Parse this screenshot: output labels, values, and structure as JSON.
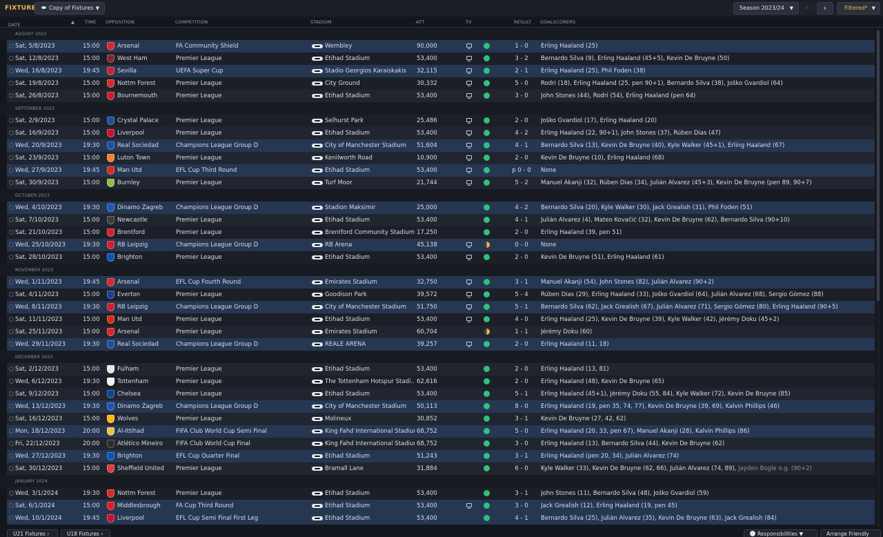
{
  "header": {
    "title": "FIXTURES",
    "view_select": "Copy of Fixtures",
    "season_select": "Season 2023/24",
    "filter_label": "Filtered*",
    "prev_icon": "chevron-left-icon",
    "next_icon": "chevron-right-icon"
  },
  "columns": {
    "date": "DATE",
    "time": "TIME",
    "opposition": "OPPOSITION",
    "competition": "COMPETITION",
    "stadium": "STADIUM",
    "att": "ATT",
    "tv": "TV",
    "result": "RESULT",
    "goalscorers": "GOALSCORERS"
  },
  "colors": {
    "accent": "#e9b94a",
    "win_dot": "#2fc27a",
    "draw_dot": "#f2b33a",
    "highlight_row": "#263752"
  },
  "groups": [
    {
      "month": "AUGUST 2023",
      "fixtures": [
        {
          "date": "Sat, 5/8/2023",
          "time": "15:00",
          "opp": "Arsenal",
          "crest": "#d8262b",
          "comp": "FA Community Shield",
          "stadium": "Wembley",
          "att": "90,000",
          "tv": true,
          "result": "1 - 0",
          "outcome": "win",
          "scorers": "Erling Haaland (25)",
          "scorers_extra": "",
          "hl": true
        },
        {
          "date": "Sat, 12/8/2023",
          "time": "15:00",
          "opp": "West Ham",
          "crest": "#7a2636",
          "comp": "Premier League",
          "stadium": "Etihad Stadium",
          "att": "53,400",
          "tv": true,
          "result": "3 - 2",
          "outcome": "win",
          "scorers": "Bernardo Silva (9), Erling Haaland (45+5), Kevin De Bruyne (50)",
          "scorers_extra": "",
          "hl": false
        },
        {
          "date": "Wed, 16/8/2023",
          "time": "19:45",
          "opp": "Sevilla",
          "crest": "#c7202c",
          "comp": "UEFA Super Cup",
          "stadium": "Stadio Georgios Karaiskakis",
          "att": "32,115",
          "tv": true,
          "result": "2 - 1",
          "outcome": "win",
          "scorers": "Erling Haaland (25), Phil Foden (38)",
          "scorers_extra": "",
          "hl": true
        },
        {
          "date": "Sat, 19/8/2023",
          "time": "15:00",
          "opp": "Nottm Forest",
          "crest": "#d12b2b",
          "comp": "Premier League",
          "stadium": "City Ground",
          "att": "30,332",
          "tv": true,
          "result": "5 - 0",
          "outcome": "win",
          "scorers": "Rodri (18), Erling Haaland (25, pen 90+1), Bernardo Silva (38), Joško Gvardiol (64)",
          "scorers_extra": "",
          "hl": false
        },
        {
          "date": "Sat, 26/8/2023",
          "time": "15:00",
          "opp": "Bournemouth",
          "crest": "#c61f2b",
          "comp": "Premier League",
          "stadium": "Etihad Stadium",
          "att": "53,400",
          "tv": true,
          "result": "3 - 0",
          "outcome": "win",
          "scorers": "John Stones (44), Rodri (54), Erling Haaland (pen 64)",
          "scorers_extra": "",
          "hl": false
        }
      ]
    },
    {
      "month": "SEPTEMBER 2023",
      "fixtures": [
        {
          "date": "Sat, 2/9/2023",
          "time": "15:00",
          "opp": "Crystal Palace",
          "crest": "#1b4e9b",
          "comp": "Premier League",
          "stadium": "Selhurst Park",
          "att": "25,486",
          "tv": true,
          "result": "2 - 0",
          "outcome": "win",
          "scorers": "Joško Gvardiol (17), Erling Haaland (20)",
          "scorers_extra": "",
          "hl": false
        },
        {
          "date": "Sat, 16/9/2023",
          "time": "15:00",
          "opp": "Liverpool",
          "crest": "#c8102e",
          "comp": "Premier League",
          "stadium": "Etihad Stadium",
          "att": "53,400",
          "tv": true,
          "result": "4 - 2",
          "outcome": "win",
          "scorers": "Erling Haaland (22, 90+1), John Stones (37), Rúben Dias (47)",
          "scorers_extra": "",
          "hl": false
        },
        {
          "date": "Wed, 20/9/2023",
          "time": "19:30",
          "opp": "Real Sociedad",
          "crest": "#1c4ea0",
          "comp": "Champions League Group D",
          "stadium": "City of Manchester Stadium",
          "att": "51,604",
          "tv": true,
          "result": "4 - 1",
          "outcome": "win",
          "scorers": "Bernardo Silva (13), Kevin De Bruyne (40), Kyle Walker (45+1), Erling Haaland (67)",
          "scorers_extra": "",
          "hl": true
        },
        {
          "date": "Sat, 23/9/2023",
          "time": "15:00",
          "opp": "Luton Town",
          "crest": "#f0822a",
          "comp": "Premier League",
          "stadium": "Kenilworth Road",
          "att": "10,900",
          "tv": true,
          "result": "2 - 0",
          "outcome": "win",
          "scorers": "Kevin De Bruyne (10), Erling Haaland (68)",
          "scorers_extra": "",
          "hl": false
        },
        {
          "date": "Wed, 27/9/2023",
          "time": "19:45",
          "opp": "Man Utd",
          "crest": "#da291c",
          "comp": "EFL Cup Third Round",
          "stadium": "Etihad Stadium",
          "att": "53,400",
          "tv": true,
          "result": "p 0 - 0",
          "outcome": "win",
          "scorers": "None",
          "scorers_extra": "",
          "hl": true
        },
        {
          "date": "Sat, 30/9/2023",
          "time": "15:00",
          "opp": "Burnley",
          "crest": "#8cbf3f",
          "comp": "Premier League",
          "stadium": "Turf Moor",
          "att": "21,744",
          "tv": true,
          "result": "5 - 2",
          "outcome": "win",
          "scorers": "Manuel Akanji (32), Rúben Dias (34), Julián Álvarez (45+3), Kevin De Bruyne (pen 89, 90+7)",
          "scorers_extra": "",
          "hl": false
        }
      ]
    },
    {
      "month": "OCTOBER 2023",
      "fixtures": [
        {
          "date": "Wed, 4/10/2023",
          "time": "19:30",
          "opp": "Dinamo Zagreb",
          "crest": "#1c55b8",
          "comp": "Champions League Group D",
          "stadium": "Stadion Maksimir",
          "att": "25,000",
          "tv": false,
          "result": "4 - 2",
          "outcome": "win",
          "scorers": "Bernardo Silva (20), Kyle Walker (30), Jack Grealish (31), Phil Foden (51)",
          "scorers_extra": "",
          "hl": true
        },
        {
          "date": "Sat, 7/10/2023",
          "time": "15:00",
          "opp": "Newcastle",
          "crest": "#3b3b3b",
          "comp": "Premier League",
          "stadium": "Etihad Stadium",
          "att": "53,400",
          "tv": false,
          "result": "4 - 1",
          "outcome": "win",
          "scorers": "Julián Álvarez (4), Mateo Kovačić (32), Kevin De Bruyne (62), Bernardo Silva (90+10)",
          "scorers_extra": "",
          "hl": false
        },
        {
          "date": "Sat, 21/10/2023",
          "time": "15:00",
          "opp": "Brentford",
          "crest": "#d81f26",
          "comp": "Premier League",
          "stadium": "Brentford Community Stadium",
          "att": "17,250",
          "tv": false,
          "result": "2 - 0",
          "outcome": "win",
          "scorers": "Erling Haaland (39, pen 51)",
          "scorers_extra": "",
          "hl": false
        },
        {
          "date": "Wed, 25/10/2023",
          "time": "19:30",
          "opp": "RB Leipzig",
          "crest": "#d01d2f",
          "comp": "Champions League Group D",
          "stadium": "RB Arena",
          "att": "45,138",
          "tv": true,
          "result": "0 - 0",
          "outcome": "draw",
          "scorers": "None",
          "scorers_extra": "",
          "hl": true
        },
        {
          "date": "Sat, 28/10/2023",
          "time": "15:00",
          "opp": "Brighton",
          "crest": "#0057b8",
          "comp": "Premier League",
          "stadium": "Etihad Stadium",
          "att": "53,400",
          "tv": true,
          "result": "2 - 0",
          "outcome": "win",
          "scorers": "Kevin De Bruyne (51), Erling Haaland (61)",
          "scorers_extra": "",
          "hl": false
        }
      ]
    },
    {
      "month": "NOVEMBER 2023",
      "fixtures": [
        {
          "date": "Wed, 1/11/2023",
          "time": "19:45",
          "opp": "Arsenal",
          "crest": "#d8262b",
          "comp": "EFL Cup Fourth Round",
          "stadium": "Emirates Stadium",
          "att": "32,750",
          "tv": true,
          "result": "3 - 1",
          "outcome": "win",
          "scorers": "Manuel Akanji (54), John Stones (82), Julián Álvarez (90+2)",
          "scorers_extra": "",
          "hl": true
        },
        {
          "date": "Sat, 4/11/2023",
          "time": "15:00",
          "opp": "Everton",
          "crest": "#1b3f94",
          "comp": "Premier League",
          "stadium": "Goodison Park",
          "att": "39,572",
          "tv": true,
          "result": "5 - 4",
          "outcome": "win",
          "scorers": "Rúben Dias (29), Erling Haaland (33), Joško Gvardiol (64), Julián Álvarez (68), Sergio Gómez (88)",
          "scorers_extra": "",
          "hl": false
        },
        {
          "date": "Wed, 8/11/2023",
          "time": "19:30",
          "opp": "RB Leipzig",
          "crest": "#d01d2f",
          "comp": "Champions League Group D",
          "stadium": "City of Manchester Stadium",
          "att": "51,750",
          "tv": true,
          "result": "5 - 1",
          "outcome": "win",
          "scorers": "Bernardo Silva (62), Jack Grealish (67), Julián Álvarez (71), Sergio Gómez (80), Erling Haaland (90+5)",
          "scorers_extra": "",
          "hl": true
        },
        {
          "date": "Sat, 11/11/2023",
          "time": "15:00",
          "opp": "Man Utd",
          "crest": "#da291c",
          "comp": "Premier League",
          "stadium": "Etihad Stadium",
          "att": "53,400",
          "tv": true,
          "result": "4 - 0",
          "outcome": "win",
          "scorers": "Erling Haaland (25), Kevin De Bruyne (39), Kyle Walker (42), Jérémy Doku (45+2)",
          "scorers_extra": "",
          "hl": false
        },
        {
          "date": "Sat, 25/11/2023",
          "time": "15:00",
          "opp": "Arsenal",
          "crest": "#d8262b",
          "comp": "Premier League",
          "stadium": "Emirates Stadium",
          "att": "60,704",
          "tv": false,
          "result": "1 - 1",
          "outcome": "draw",
          "scorers": "Jérémy Doku (60)",
          "scorers_extra": "",
          "hl": false
        },
        {
          "date": "Wed, 29/11/2023",
          "time": "19:30",
          "opp": "Real Sociedad",
          "crest": "#1c4ea0",
          "comp": "Champions League Group D",
          "stadium": "REALE ARENA",
          "att": "39,257",
          "tv": true,
          "result": "2 - 0",
          "outcome": "win",
          "scorers": "Erling Haaland (11, 18)",
          "scorers_extra": "",
          "hl": true
        }
      ]
    },
    {
      "month": "DECEMBER 2023",
      "fixtures": [
        {
          "date": "Sat, 2/12/2023",
          "time": "15:00",
          "opp": "Fulham",
          "crest": "#e6e6e6",
          "comp": "Premier League",
          "stadium": "Etihad Stadium",
          "att": "53,400",
          "tv": false,
          "result": "2 - 0",
          "outcome": "win",
          "scorers": "Erling Haaland (13, 81)",
          "scorers_extra": "",
          "hl": false
        },
        {
          "date": "Wed, 6/12/2023",
          "time": "19:30",
          "opp": "Tottenham",
          "crest": "#f2f2f2",
          "comp": "Premier League",
          "stadium": "The Tottenham Hotspur Stadi...",
          "att": "62,616",
          "tv": false,
          "result": "2 - 0",
          "outcome": "win",
          "scorers": "Erling Haaland (48), Kevin De Bruyne (65)",
          "scorers_extra": "",
          "hl": false
        },
        {
          "date": "Sat, 9/12/2023",
          "time": "15:00",
          "opp": "Chelsea",
          "crest": "#034694",
          "comp": "Premier League",
          "stadium": "Etihad Stadium",
          "att": "53,400",
          "tv": false,
          "result": "5 - 1",
          "outcome": "win",
          "scorers": "Erling Haaland (45+1), Jérémy Doku (55, 84), Kyle Walker (72), Kevin De Bruyne (85)",
          "scorers_extra": "",
          "hl": false
        },
        {
          "date": "Wed, 13/12/2023",
          "time": "19:30",
          "opp": "Dinamo Zagreb",
          "crest": "#1c55b8",
          "comp": "Champions League Group D",
          "stadium": "City of Manchester Stadium",
          "att": "50,113",
          "tv": false,
          "result": "8 - 0",
          "outcome": "win",
          "scorers": "Erling Haaland (19, pen 35, 74, 77), Kevin De Bruyne (39, 69), Kalvin Phillips (46)",
          "scorers_extra": "",
          "hl": true
        },
        {
          "date": "Sat, 16/12/2023",
          "time": "15:00",
          "opp": "Wolves",
          "crest": "#fdb913",
          "comp": "Premier League",
          "stadium": "Molineux",
          "att": "30,852",
          "tv": false,
          "result": "3 - 1",
          "outcome": "win",
          "scorers": "Kevin De Bruyne (27, 42, 62)",
          "scorers_extra": "",
          "hl": false
        },
        {
          "date": "Mon, 18/12/2023",
          "time": "20:00",
          "opp": "Al-Ittihad",
          "crest": "#e8c34a",
          "comp": "FIFA Club World Cup Semi Final",
          "stadium": "King Fahd International Stadium",
          "att": "68,752",
          "tv": false,
          "result": "5 - 0",
          "outcome": "win",
          "scorers": "Erling Haaland (20, 33, pen 67), Manuel Akanji (28), Kalvin Phillips (86)",
          "scorers_extra": "",
          "hl": true
        },
        {
          "date": "Fri, 22/12/2023",
          "time": "20:00",
          "opp": "Atlético Mineiro",
          "crest": "#2a2a2a",
          "comp": "FIFA Club World Cup Final",
          "stadium": "King Fahd International Stadium",
          "att": "68,752",
          "tv": false,
          "result": "3 - 0",
          "outcome": "win",
          "scorers": "Erling Haaland (13), Bernardo Silva (44), Kevin De Bruyne (62)",
          "scorers_extra": "",
          "hl": false
        },
        {
          "date": "Wed, 27/12/2023",
          "time": "19:30",
          "opp": "Brighton",
          "crest": "#0057b8",
          "comp": "EFL Cup Quarter Final",
          "stadium": "Etihad Stadium",
          "att": "51,243",
          "tv": false,
          "result": "3 - 1",
          "outcome": "win",
          "scorers": "Erling Haaland (pen 20, 34), Julián Álvarez (74)",
          "scorers_extra": "",
          "hl": true
        },
        {
          "date": "Sat, 30/12/2023",
          "time": "15:00",
          "opp": "Sheffield United",
          "crest": "#e03a3e",
          "comp": "Premier League",
          "stadium": "Bramall Lane",
          "att": "31,884",
          "tv": false,
          "result": "6 - 0",
          "outcome": "win",
          "scorers": "Kyle Walker (33), Kevin De Bruyne (62, 66), Julián Álvarez (74, 89),",
          "scorers_extra": " Jayden Bogle o.g. (90+2)",
          "hl": false
        }
      ]
    },
    {
      "month": "JANUARY 2024",
      "fixtures": [
        {
          "date": "Wed, 3/1/2024",
          "time": "19:30",
          "opp": "Nottm Forest",
          "crest": "#d12b2b",
          "comp": "Premier League",
          "stadium": "Etihad Stadium",
          "att": "53,400",
          "tv": false,
          "result": "3 - 1",
          "outcome": "win",
          "scorers": "John Stones (11), Bernardo Silva (48), Joško Gvardiol (59)",
          "scorers_extra": "",
          "hl": false
        },
        {
          "date": "Sat, 6/1/2024",
          "time": "15:00",
          "opp": "Middlesbrough",
          "crest": "#e11b22",
          "comp": "FA Cup Third Round",
          "stadium": "Etihad Stadium",
          "att": "53,400",
          "tv": true,
          "result": "3 - 0",
          "outcome": "win",
          "scorers": "Jack Grealish (12), Erling Haaland (19, pen 45)",
          "scorers_extra": "",
          "hl": true
        },
        {
          "date": "Wed, 10/1/2024",
          "time": "19:45",
          "opp": "Liverpool",
          "crest": "#c8102e",
          "comp": "EFL Cup Semi Final First Leg",
          "stadium": "Etihad Stadium",
          "att": "53,400",
          "tv": false,
          "result": "4 - 1",
          "outcome": "win",
          "scorers": "Bernardo Silva (25), Julián Álvarez (35), Kevin De Bruyne (63), Jack Grealish (84)",
          "scorers_extra": "",
          "hl": true
        }
      ]
    }
  ],
  "footer": {
    "u21": "U21 Fixtures",
    "u18": "U18 Fixtures",
    "responsibilities": "Responsibilities",
    "arrange": "Arrange Friendly"
  }
}
